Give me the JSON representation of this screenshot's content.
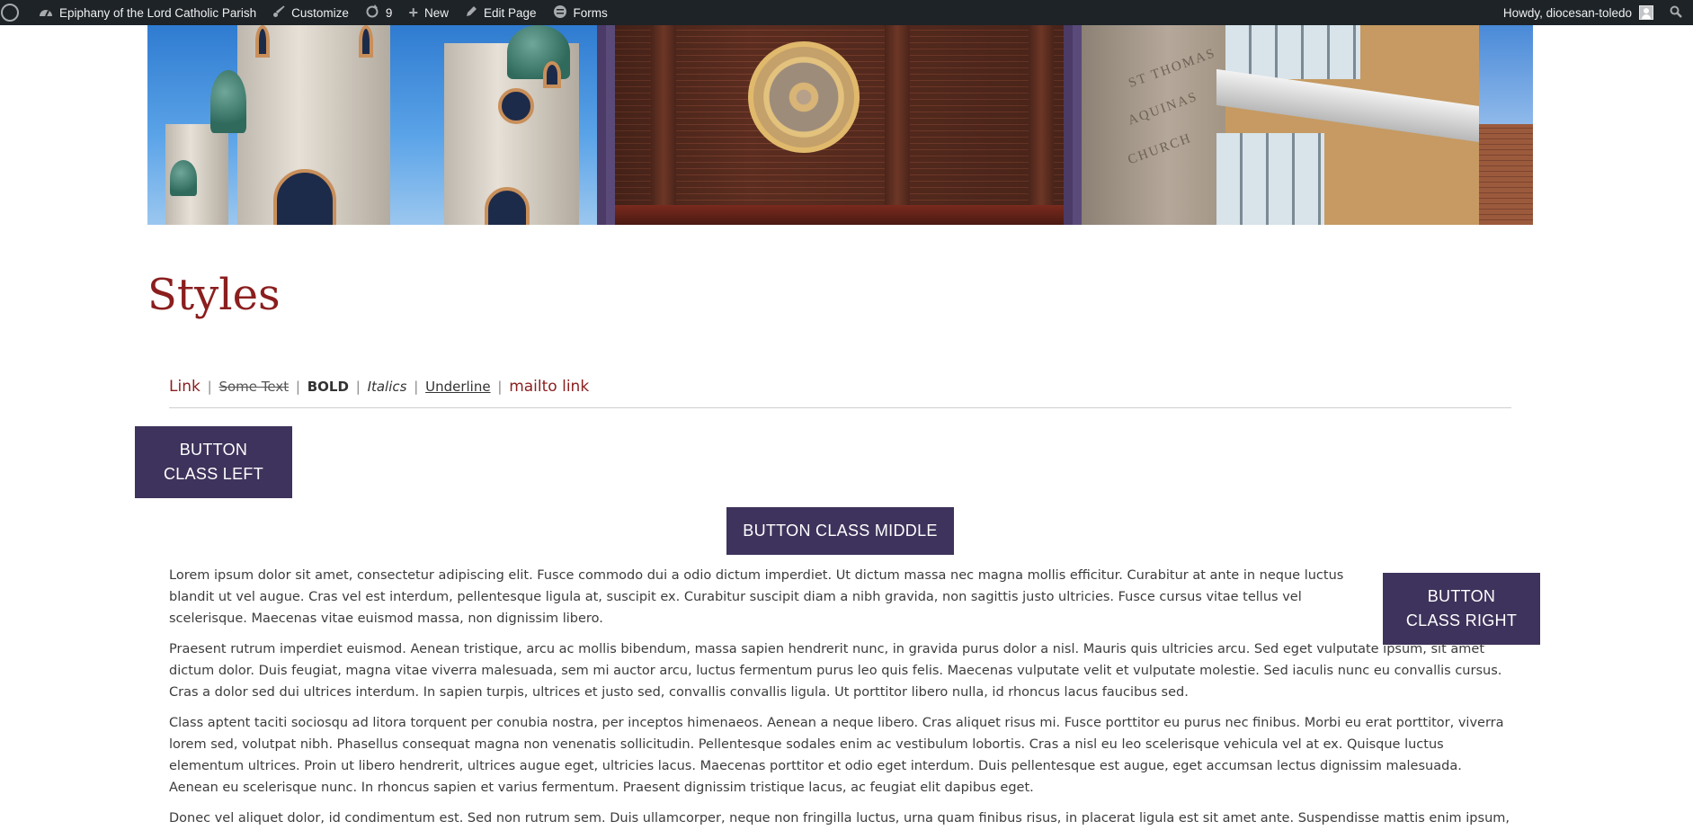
{
  "adminbar": {
    "site_name": "Epiphany of the Lord Catholic Parish",
    "customize": "Customize",
    "updates_count": "9",
    "new_label": "New",
    "edit_page": "Edit Page",
    "forms": "Forms",
    "howdy": "Howdy, diocesan-toledo"
  },
  "banner": {
    "sign_letters": [
      "ST THOMAS",
      "AQUINAS",
      "CHURCH"
    ]
  },
  "page": {
    "title": "Styles",
    "links": {
      "link": "Link",
      "strike": "Some Text",
      "bold": "BOLD",
      "italic": "Italics",
      "underline": "Underline",
      "mailto": "mailto link",
      "separator": "|"
    },
    "buttons": {
      "left_line1": "BUTTON",
      "left_line2": "CLASS LEFT",
      "middle": "BUTTON CLASS MIDDLE",
      "right_line1": "BUTTON",
      "right_line2": "CLASS RIGHT"
    },
    "paragraphs": [
      "Lorem ipsum dolor sit amet, consectetur adipiscing elit. Fusce commodo dui a odio dictum imperdiet. Ut dictum massa nec magna mollis efficitur. Curabitur at ante in neque luctus blandit ut vel augue. Cras vel est interdum, pellentesque ligula at, suscipit ex. Curabitur suscipit diam a nibh gravida, non sagittis justo ultricies. Fusce cursus vitae tellus vel scelerisque. Maecenas vitae euismod massa, non dignissim libero.",
      "Praesent rutrum imperdiet euismod. Aenean tristique, arcu ac mollis bibendum, massa sapien hendrerit nunc, in gravida purus dolor a nisl. Mauris quis ultricies arcu. Sed eget vulputate ipsum, sit amet dictum dolor. Duis feugiat, magna vitae viverra malesuada, sem mi auctor arcu, luctus fermentum purus leo quis felis. Maecenas vulputate velit et vulputate molestie. Sed iaculis nunc eu convallis cursus. Cras a dolor sed dui ultrices interdum. In sapien turpis, ultrices et justo sed, convallis convallis ligula. Ut porttitor libero nulla, id rhoncus lacus faucibus sed.",
      "Class aptent taciti sociosqu ad litora torquent per conubia nostra, per inceptos himenaeos. Aenean a neque libero. Cras aliquet risus mi. Fusce porttitor eu purus nec finibus. Morbi eu erat porttitor, viverra lorem sed, volutpat nibh. Phasellus consequat magna non venenatis sollicitudin. Pellentesque sodales enim ac vestibulum lobortis. Cras a nisl eu leo scelerisque vehicula vel at ex. Quisque luctus elementum ultrices. Proin ut libero hendrerit, ultrices augue eget, ultricies lacus. Maecenas porttitor et odio eget interdum. Duis pellentesque est augue, eget accumsan lectus dignissim malesuada. Aenean eu scelerisque nunc. In rhoncus sapien et varius fermentum. Praesent dignissim tristique lacus, ac feugiat elit dapibus eget.",
      "Donec vel aliquet dolor, id condimentum est. Sed non rutrum sem. Duis ullamcorper, neque non fringilla luctus, urna quam finibus risus, in placerat ligula est sit amet ante. Suspendisse mattis enim ipsum, in blandit"
    ]
  },
  "colors": {
    "adminbar_bg": "#1d2327",
    "title_red": "#8b1e1e",
    "button_purple": "#3e335c"
  },
  "icons": [
    "wordpress-icon",
    "dashboard-icon",
    "brush-icon",
    "updates-icon",
    "plus-icon",
    "pencil-icon",
    "forms-icon",
    "avatar-icon",
    "search-icon"
  ]
}
